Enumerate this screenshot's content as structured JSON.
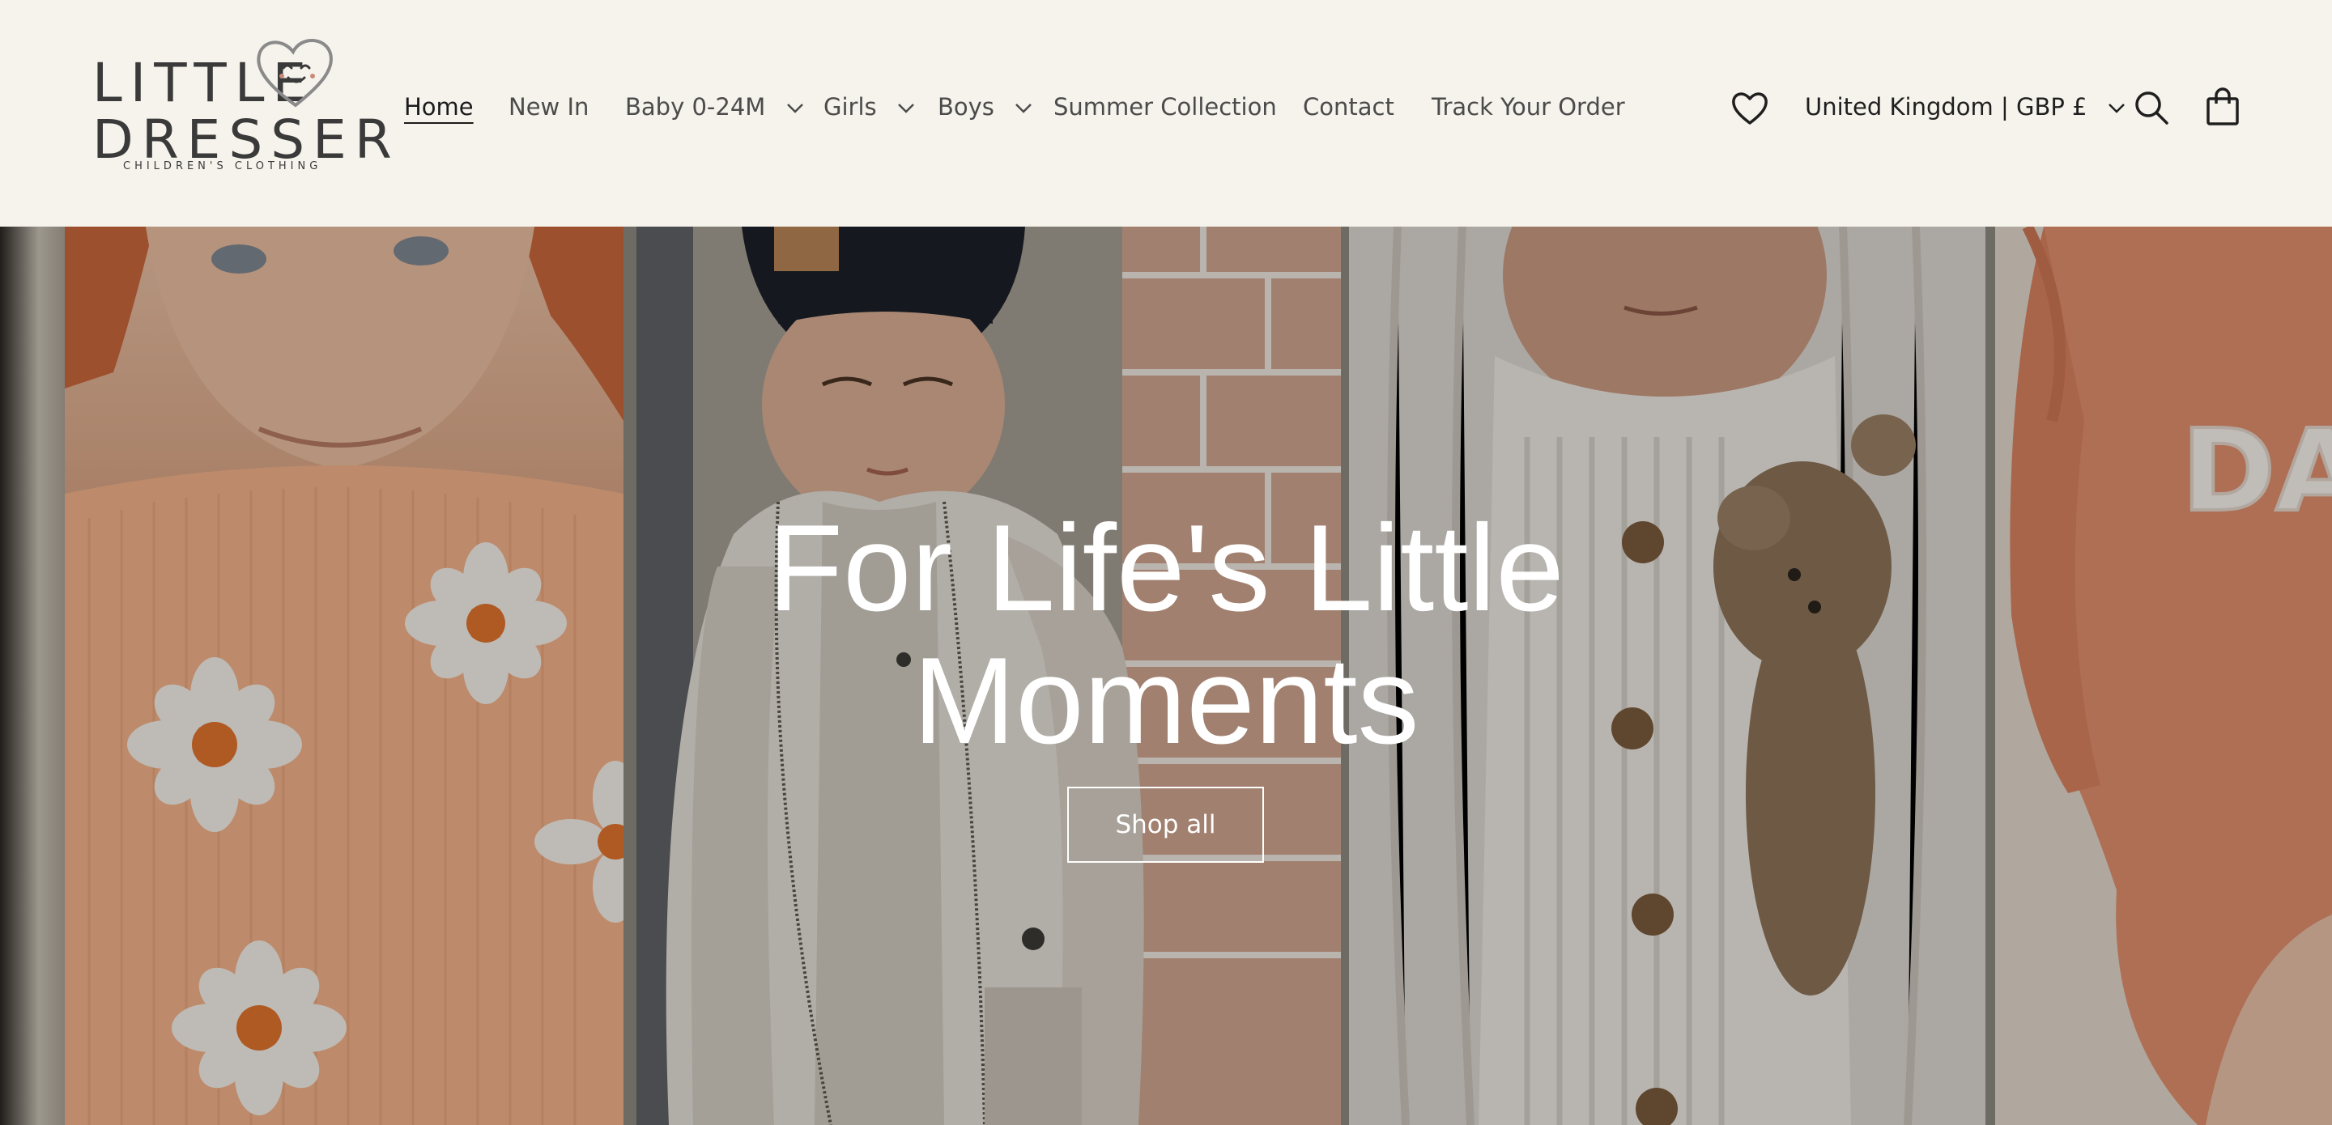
{
  "brand": {
    "logo_line1": "LITTLE",
    "logo_line2": "DRESSER",
    "tagline": "CHILDREN'S CLOTHING"
  },
  "nav": {
    "items": [
      {
        "label": "Home",
        "active": true,
        "dropdown": false
      },
      {
        "label": "New In",
        "active": false,
        "dropdown": false
      },
      {
        "label": "Baby 0-24M",
        "active": false,
        "dropdown": true
      },
      {
        "label": "Girls",
        "active": false,
        "dropdown": true
      },
      {
        "label": "Boys",
        "active": false,
        "dropdown": true
      },
      {
        "label": "Summer Collection",
        "active": false,
        "dropdown": false
      },
      {
        "label": "Contact",
        "active": false,
        "dropdown": false
      },
      {
        "label": "Track Your Order",
        "active": false,
        "dropdown": false
      }
    ]
  },
  "header_right": {
    "wishlist_icon": "heart-icon",
    "locale": "United Kingdom | GBP £",
    "search_icon": "search-icon",
    "cart_icon": "bag-icon"
  },
  "hero": {
    "title_line1": "For Life's Little",
    "title_line2": "Moments",
    "cta_label": "Shop all",
    "sweater_text": "DAI GI"
  },
  "colors": {
    "header_bg": "#f6f3ec",
    "text": "#2c2c2c",
    "hero_text": "#ffffff"
  }
}
